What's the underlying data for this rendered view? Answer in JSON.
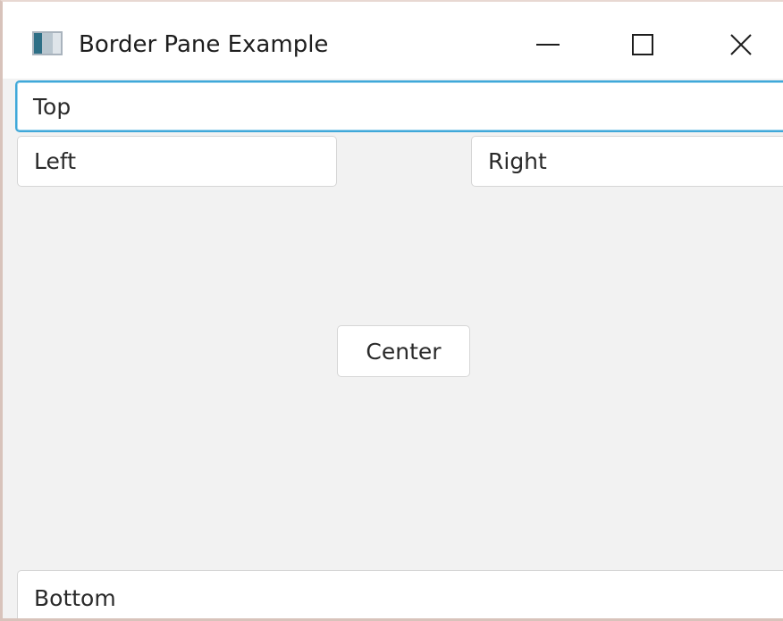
{
  "window": {
    "title": "Border Pane Example",
    "icon": "java-app-icon",
    "controls": {
      "minimize_icon": "minimize-icon",
      "maximize_icon": "maximize-icon",
      "close_icon": "close-icon"
    }
  },
  "border_pane": {
    "top_label": "Top",
    "left_label": "Left",
    "right_label": "Right",
    "center_label": "Center",
    "bottom_label": "Bottom"
  },
  "colors": {
    "focus_ring": "#3fa8d9",
    "pane_background": "#f2f2f2",
    "button_background": "#ffffff"
  }
}
